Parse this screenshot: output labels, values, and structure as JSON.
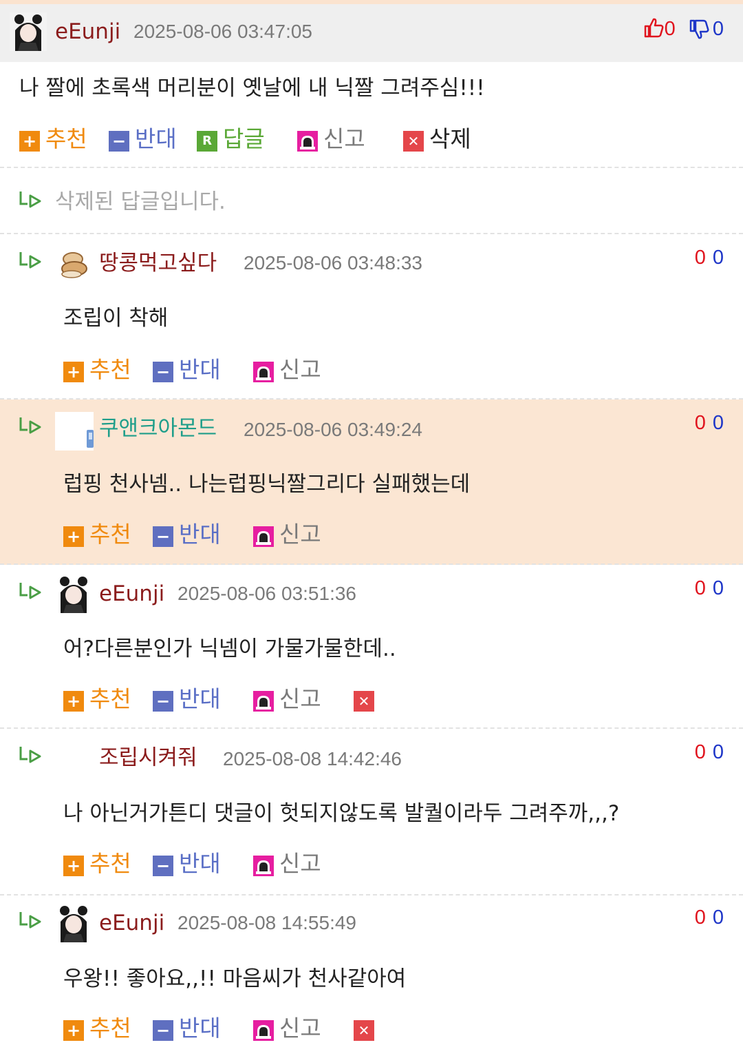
{
  "labels": {
    "recommend": "추천",
    "oppose": "반대",
    "reply": "답글",
    "report": "신고",
    "delete": "삭제"
  },
  "colors": {
    "recommend": "#f08a0e",
    "oppose": "#5f6fc0",
    "reply": "#5aa836",
    "delete": "#e4464a",
    "nick_default": "#8b1c1c",
    "nick_highlight": "#1e9e8a",
    "highlight_bg": "#fbe6d3"
  },
  "comments": [
    {
      "nick": "eEunji",
      "time": "2025-08-06 03:47:05",
      "up": "0",
      "down": "0",
      "body": "나 짤에 초록색 머리분이 옛날에 내 닉짤 그려주심!!!"
    },
    {
      "deleted_text": "삭제된 답글입니다."
    },
    {
      "nick": "땅콩먹고싶다",
      "time": "2025-08-06 03:48:33",
      "up": "0",
      "down": "0",
      "body": "조립이 착해"
    },
    {
      "nick": "쿠앤크아몬드",
      "time": "2025-08-06 03:49:24",
      "up": "0",
      "down": "0",
      "body": "럽핑 천사넴.. 나는럽핑닉짤그리다 실패했는데"
    },
    {
      "nick": "eEunji",
      "time": "2025-08-06 03:51:36",
      "up": "0",
      "down": "0",
      "body": "어?다른분인가 닉넴이 가물가물한데.."
    },
    {
      "nick": "조립시켜줘",
      "time": "2025-08-08 14:42:46",
      "up": "0",
      "down": "0",
      "body": "나 아닌거가튼디 댓글이 헛되지않도록 발퀄이라두 그려주까,,,?"
    },
    {
      "nick": "eEunji",
      "time": "2025-08-08 14:55:49",
      "up": "0",
      "down": "0",
      "body": "우왕!! 좋아요,,!! 마음씨가 천사같아여"
    }
  ]
}
